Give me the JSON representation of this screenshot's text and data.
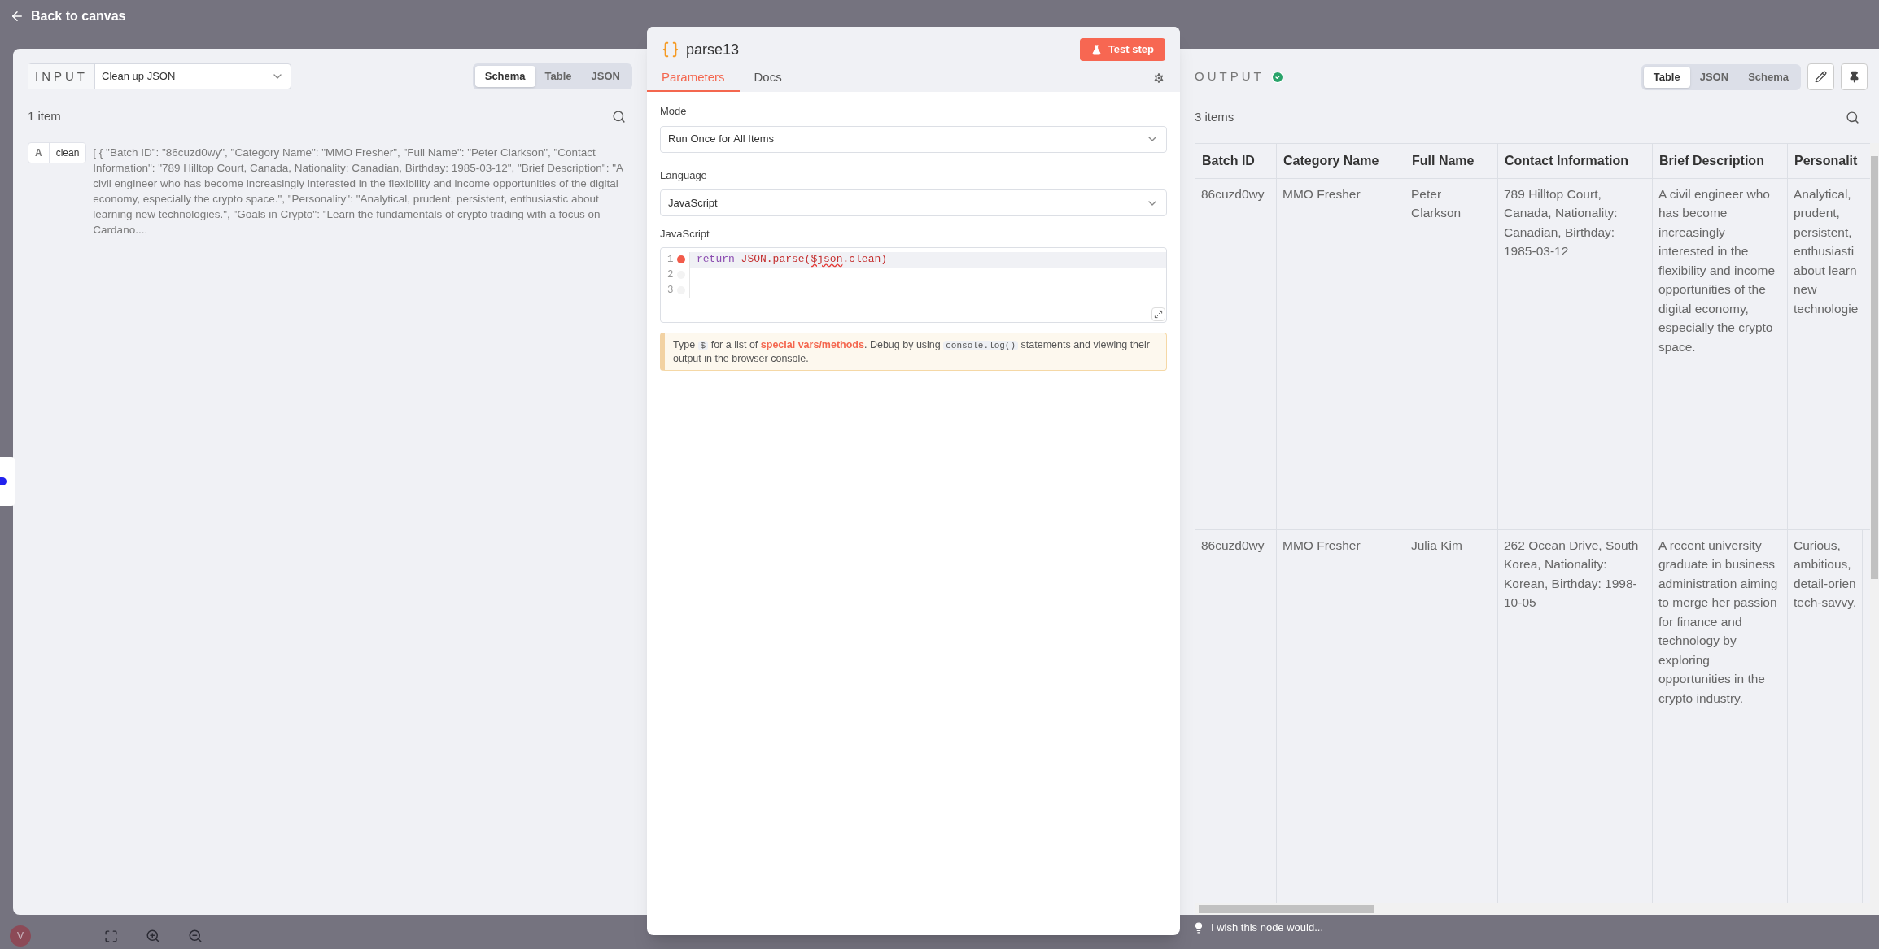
{
  "canvas": {
    "back_link": "Back to canvas",
    "avatar": "V",
    "feedback": "I wish this node would..."
  },
  "input": {
    "label": "INPUT",
    "node_select": "Clean up JSON",
    "views": [
      {
        "label": "Schema",
        "selected": true
      },
      {
        "label": "Table",
        "selected": false
      },
      {
        "label": "JSON",
        "selected": false
      }
    ],
    "count": "1 item",
    "fields": [
      {
        "type_badge": "A",
        "name": "clean",
        "value": "[ { \"Batch ID\": \"86cuzd0wy\", \"Category Name\": \"MMO Fresher\", \"Full Name\": \"Peter Clarkson\", \"Contact Information\": \"789 Hilltop Court, Canada, Nationality: Canadian, Birthday: 1985-03-12\", \"Brief Description\": \"A civil engineer who has become increasingly interested in the flexibility and income opportunities of the digital economy, especially the crypto space.\", \"Personality\": \"Analytical, prudent, persistent, enthusiastic about learning new technologies.\", \"Goals in Crypto\": \"Learn the fundamentals of crypto trading with a focus on Cardano...."
      }
    ]
  },
  "node": {
    "title": "parse13",
    "test_button": "Test step",
    "tabs": [
      {
        "label": "Parameters",
        "selected": true
      },
      {
        "label": "Docs",
        "selected": false
      }
    ],
    "params": [
      {
        "label": "Mode",
        "value": "Run Once for All Items"
      },
      {
        "label": "Language",
        "value": "JavaScript"
      }
    ],
    "code_label": "JavaScript",
    "code_lines": [
      {
        "number": "1",
        "breakpoint": true,
        "active": true,
        "tokens": [
          {
            "kind": "keyword",
            "text": "return "
          },
          {
            "kind": "call",
            "text": "JSON.parse("
          },
          {
            "kind": "error",
            "text": "$json"
          },
          {
            "kind": "call",
            "text": ".clean)"
          }
        ]
      },
      {
        "number": "2",
        "breakpoint": false,
        "active": false
      },
      {
        "number": "3",
        "breakpoint": false,
        "active": false
      }
    ],
    "hint": [
      {
        "kind": "text",
        "text": "Type "
      },
      {
        "kind": "code",
        "text": "$"
      },
      {
        "kind": "text",
        "text": " for a list of "
      },
      {
        "kind": "link",
        "text": "special vars/methods"
      },
      {
        "kind": "text",
        "text": ". Debug by using "
      },
      {
        "kind": "code",
        "text": "console.log()"
      },
      {
        "kind": "text",
        "text": " statements and viewing their output in the browser console."
      }
    ]
  },
  "output": {
    "label": "OUTPUT",
    "success": true,
    "views": [
      {
        "label": "Table",
        "selected": true
      },
      {
        "label": "JSON",
        "selected": false
      },
      {
        "label": "Schema",
        "selected": false
      }
    ],
    "count": "3 items",
    "columns": [
      "Batch ID",
      "Category Name",
      "Full Name",
      "Contact Information",
      "Brief Description",
      "Personalit"
    ],
    "rows": [
      {
        "cells": [
          "86cuzd0wy",
          "MMO Fresher",
          "Peter Clarkson",
          "789 Hilltop Court, Canada, Nationality: Canadian, Birthday: 1985-03-12",
          "A civil engineer who has become increasingly interested in the flexibility and income opportunities of the digital economy, especially the crypto space.",
          [
            "Analytical,",
            "prudent,",
            "persistent,",
            "enthusiasti",
            "about learn",
            "new",
            "technologie"
          ]
        ]
      },
      {
        "cells": [
          "86cuzd0wy",
          "MMO Fresher",
          "Julia Kim",
          "262 Ocean Drive, South Korea, Nationality: Korean, Birthday: 1998-10-05",
          "A recent university graduate in business administration aiming to merge her passion for finance and technology by exploring opportunities in the crypto industry.",
          [
            "Curious,",
            "ambitious,",
            "detail-orien",
            "tech-savvy."
          ]
        ]
      }
    ]
  }
}
